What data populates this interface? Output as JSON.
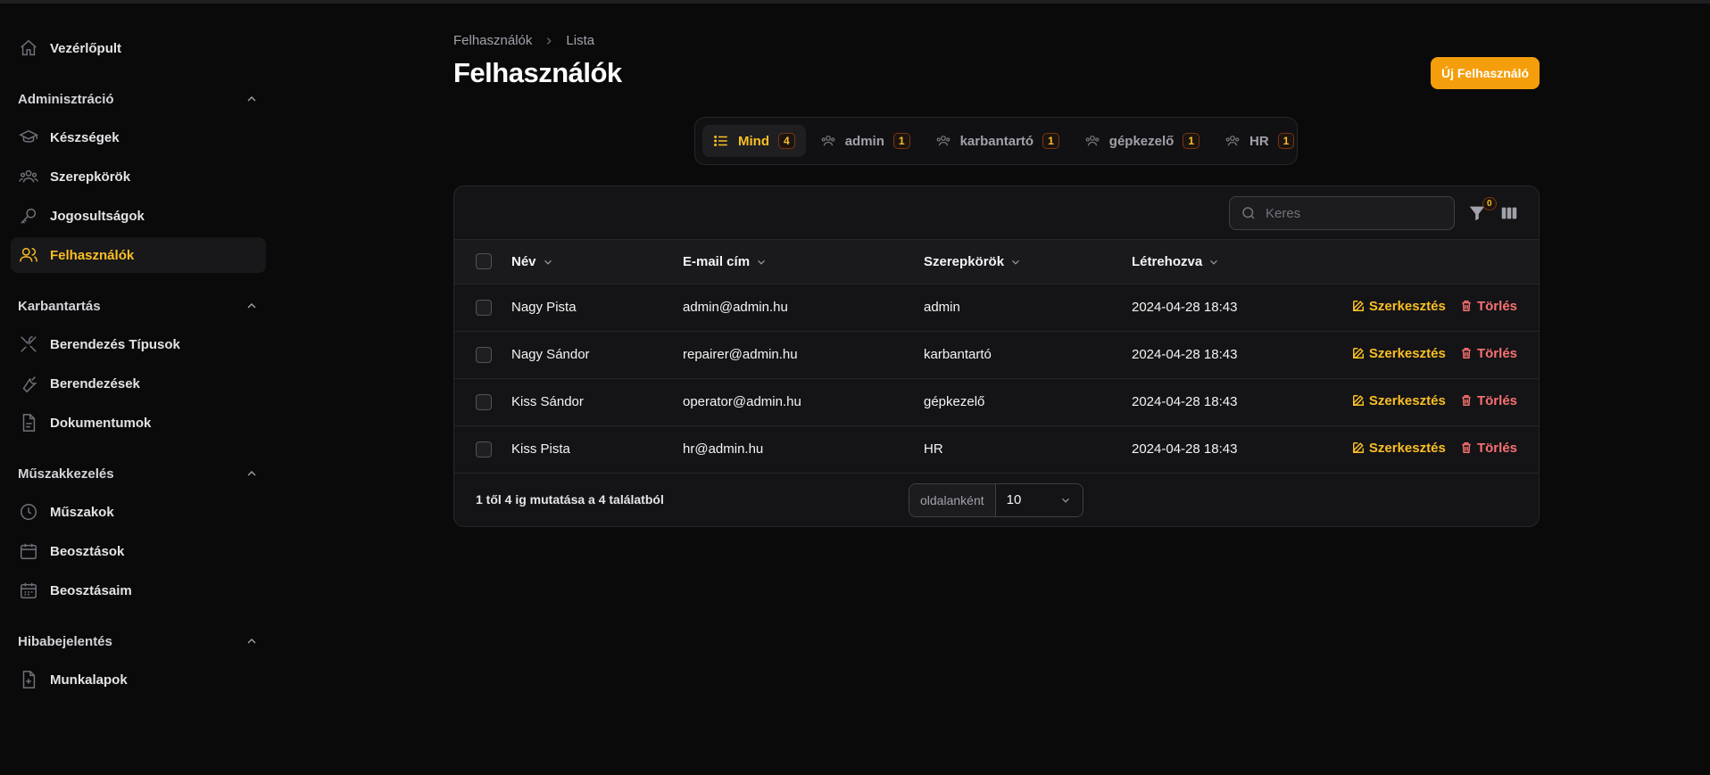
{
  "sidebar": {
    "dashboard": "Vezérlőpult",
    "groups": [
      {
        "label": "Adminisztráció",
        "items": [
          "Készségek",
          "Szerepkörök",
          "Jogosultságok",
          "Felhasználók"
        ]
      },
      {
        "label": "Karbantartás",
        "items": [
          "Berendezés Típusok",
          "Berendezések",
          "Dokumentumok"
        ]
      },
      {
        "label": "Műszakkezelés",
        "items": [
          "Műszakok",
          "Beosztások",
          "Beosztásaim"
        ]
      },
      {
        "label": "Hibabejelentés",
        "items": [
          "Munkalapok"
        ]
      }
    ],
    "active_item": "Felhasználók"
  },
  "header": {
    "breadcrumb": [
      "Felhasználók",
      "Lista"
    ],
    "title": "Felhasználók",
    "new_button": "Új Felhasználó"
  },
  "tabs": [
    {
      "label": "Mind",
      "count": "4",
      "icon": "list-icon",
      "active": true
    },
    {
      "label": "admin",
      "count": "1",
      "icon": "users-icon"
    },
    {
      "label": "karbantartó",
      "count": "1",
      "icon": "users-icon"
    },
    {
      "label": "gépkezelő",
      "count": "1",
      "icon": "users-icon"
    },
    {
      "label": "HR",
      "count": "1",
      "icon": "users-icon"
    }
  ],
  "table": {
    "search_placeholder": "Keres",
    "filter_count": "0",
    "columns": [
      "Név",
      "E-mail cím",
      "Szerepkörök",
      "Létrehozva"
    ],
    "rows": [
      {
        "name": "Nagy Pista",
        "email": "admin@admin.hu",
        "role": "admin",
        "created": "2024-04-28 18:43"
      },
      {
        "name": "Nagy Sándor",
        "email": "repairer@admin.hu",
        "role": "karbantartó",
        "created": "2024-04-28 18:43"
      },
      {
        "name": "Kiss Sándor",
        "email": "operator@admin.hu",
        "role": "gépkezelő",
        "created": "2024-04-28 18:43"
      },
      {
        "name": "Kiss Pista",
        "email": "hr@admin.hu",
        "role": "HR",
        "created": "2024-04-28 18:43"
      }
    ],
    "edit_label": "Szerkesztés",
    "delete_label": "Törlés",
    "summary": "1 től 4 ig mutatása a 4 találatból",
    "per_page_label": "oldalanként",
    "per_page_value": "10"
  },
  "colors": {
    "accent": "#f59e0b",
    "danger": "#f87171",
    "background": "#0a0a0b"
  }
}
